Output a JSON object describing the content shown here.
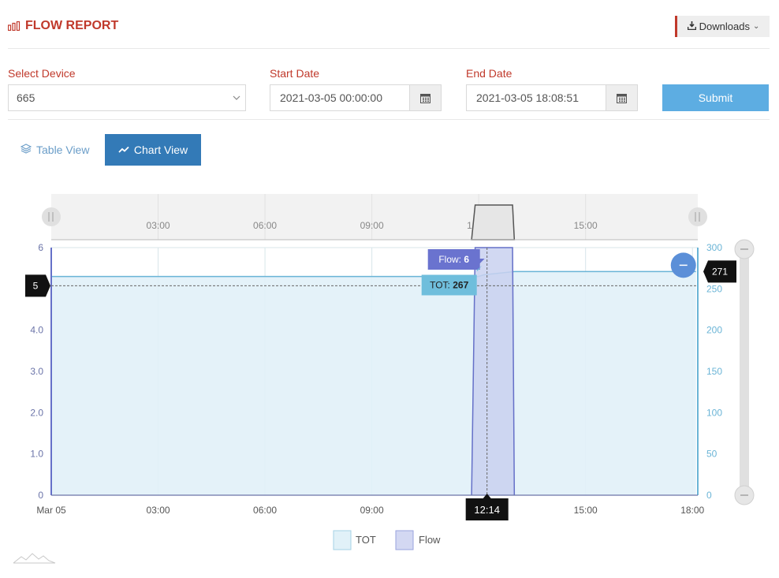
{
  "header": {
    "title": "FLOW REPORT",
    "downloads_label": "Downloads"
  },
  "filters": {
    "device_label": "Select Device",
    "device_value": "665",
    "start_label": "Start Date",
    "start_value": "2021-03-05 00:00:00",
    "end_label": "End Date",
    "end_value": "2021-03-05 18:08:51",
    "submit_label": "Submit"
  },
  "tabs": [
    {
      "label": "Table View",
      "active": false
    },
    {
      "label": "Chart View",
      "active": true
    }
  ],
  "colors": {
    "brand_red": "#c0392b",
    "primary_blue": "#337ab7",
    "submit_blue": "#5dade2",
    "tot_fill": "#e1f1f8",
    "tot_line": "#6ab4d6",
    "flow_fill": "#c9d1f0",
    "flow_line": "#6570c8"
  },
  "chart_data": {
    "type": "area",
    "navigator_ticks": [
      "03:00",
      "06:00",
      "09:00",
      "12:00",
      "15:00"
    ],
    "x_ticks": [
      "Mar 05",
      "03:00",
      "06:00",
      "09:00",
      "12:00",
      "15:00",
      "18:00"
    ],
    "x_tick_hours": [
      0,
      3,
      6,
      9,
      12,
      15,
      18
    ],
    "x_range_hours": [
      0,
      18.15
    ],
    "y_left": {
      "ticks": [
        "0",
        "1.0",
        "2.0",
        "3.0",
        "4.0",
        "5.0",
        "6"
      ],
      "range": [
        0,
        6
      ]
    },
    "y_right": {
      "ticks": [
        "0",
        "50",
        "100",
        "150",
        "200",
        "250",
        "300"
      ],
      "range": [
        0,
        300
      ]
    },
    "series": [
      {
        "name": "TOT",
        "axis": "right",
        "points": [
          [
            0,
            265
          ],
          [
            12.0,
            265
          ],
          [
            12.14,
            267
          ],
          [
            13.0,
            271
          ],
          [
            18.1,
            271
          ]
        ]
      },
      {
        "name": "Flow",
        "axis": "left",
        "points": [
          [
            11.8,
            0
          ],
          [
            11.9,
            6
          ],
          [
            12.95,
            6
          ],
          [
            13.0,
            0
          ]
        ]
      }
    ],
    "crosshair": {
      "x_label": "12:14",
      "left_label": "5",
      "right_label": "271",
      "tooltip_flow_name": "Flow: ",
      "tooltip_flow_value": "6",
      "tooltip_tot_name": "TOT: ",
      "tooltip_tot_value": "267"
    },
    "legend": [
      "TOT",
      "Flow"
    ],
    "grid": true,
    "legend_position": "bottom"
  }
}
